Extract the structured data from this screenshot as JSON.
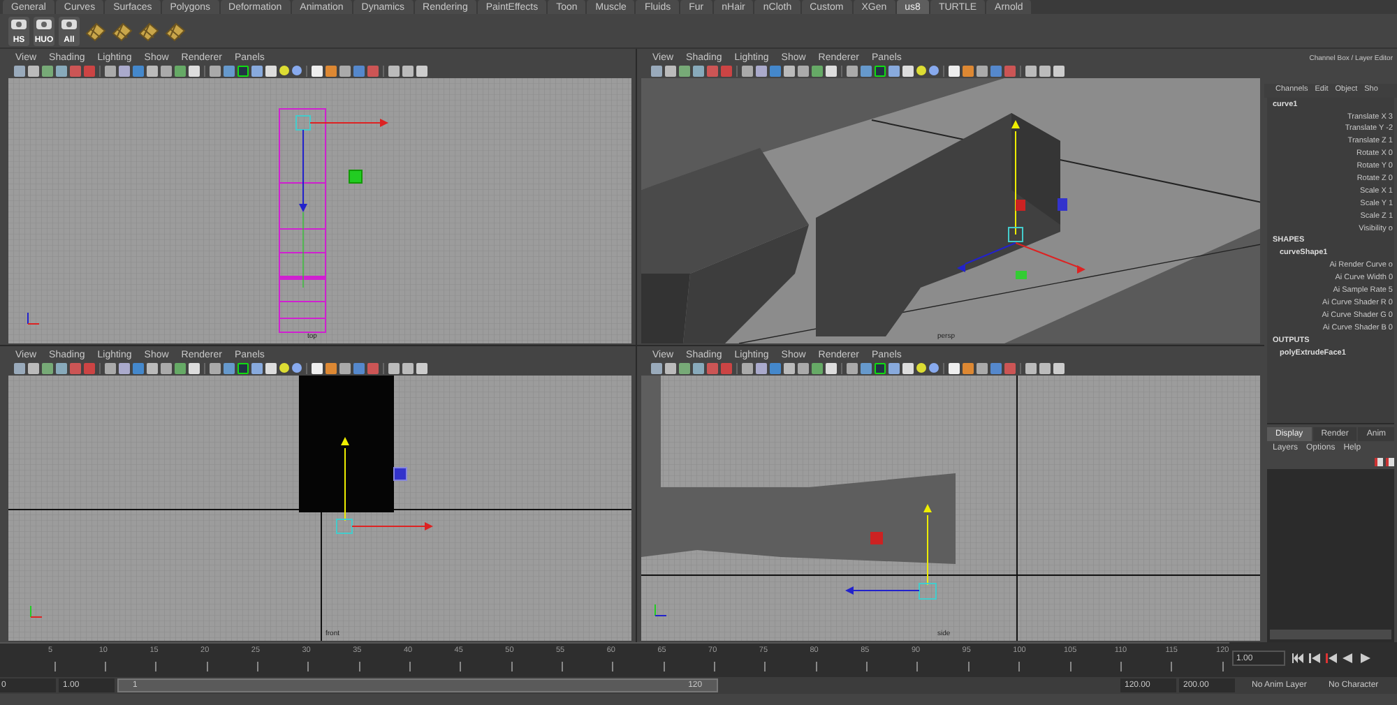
{
  "shelf_tabs": [
    {
      "label": "General",
      "selected": false
    },
    {
      "label": "Curves",
      "selected": false
    },
    {
      "label": "Surfaces",
      "selected": false
    },
    {
      "label": "Polygons",
      "selected": false
    },
    {
      "label": "Deformation",
      "selected": false
    },
    {
      "label": "Animation",
      "selected": false
    },
    {
      "label": "Dynamics",
      "selected": false
    },
    {
      "label": "Rendering",
      "selected": false
    },
    {
      "label": "PaintEffects",
      "selected": false
    },
    {
      "label": "Toon",
      "selected": false
    },
    {
      "label": "Muscle",
      "selected": false
    },
    {
      "label": "Fluids",
      "selected": false
    },
    {
      "label": "Fur",
      "selected": false
    },
    {
      "label": "nHair",
      "selected": false
    },
    {
      "label": "nCloth",
      "selected": false
    },
    {
      "label": "Custom",
      "selected": false
    },
    {
      "label": "XGen",
      "selected": false
    },
    {
      "label": "us8",
      "selected": true
    },
    {
      "label": "TURTLE",
      "selected": false
    },
    {
      "label": "Arnold",
      "selected": false
    }
  ],
  "shelf_buttons": [
    {
      "kind": "camera",
      "label": "HS"
    },
    {
      "kind": "camera",
      "label": "HUO"
    },
    {
      "kind": "camera",
      "label": "All"
    },
    {
      "kind": "tile"
    },
    {
      "kind": "tile"
    },
    {
      "kind": "tile"
    },
    {
      "kind": "tile"
    }
  ],
  "viewports": [
    {
      "kind": "top",
      "menus": [
        "View",
        "Shading",
        "Lighting",
        "Show",
        "Renderer",
        "Panels"
      ],
      "camera": "top"
    },
    {
      "kind": "persp",
      "menus": [
        "View",
        "Shading",
        "Lighting",
        "Show",
        "Renderer",
        "Panels"
      ],
      "camera": "persp"
    },
    {
      "kind": "front",
      "menus": [
        "View",
        "Shading",
        "Lighting",
        "Show",
        "Renderer",
        "Panels"
      ],
      "camera": "front"
    },
    {
      "kind": "side",
      "menus": [
        "View",
        "Shading",
        "Lighting",
        "Show",
        "Renderer",
        "Panels"
      ],
      "camera": "side"
    }
  ],
  "channel_box": {
    "title": "Channel Box / Layer Editor",
    "menus": [
      "Channels",
      "Edit",
      "Object",
      "Sho"
    ],
    "node": "curve1",
    "attributes": [
      "Translate X 3",
      "Translate Y -2",
      "Translate Z 1",
      "Rotate X 0",
      "Rotate Y 0",
      "Rotate Z 0",
      "Scale X 1",
      "Scale Y 1",
      "Scale Z 1",
      "Visibility o"
    ],
    "shapes_header": "SHAPES",
    "shape_node": "curveShape1",
    "shape_attributes": [
      "Ai Render Curve o",
      "Ai Curve Width 0",
      "Ai Sample Rate 5",
      "Ai Curve Shader R 0",
      "Ai Curve Shader G 0",
      "Ai Curve Shader B 0"
    ],
    "outputs_header": "OUTPUTS",
    "output_node": "polyExtrudeFace1"
  },
  "layer_editor": {
    "tabs": [
      {
        "label": "Display",
        "selected": true
      },
      {
        "label": "Render",
        "selected": false
      },
      {
        "label": "Anim",
        "selected": false
      }
    ],
    "menus": [
      "Layers",
      "Options",
      "Help"
    ]
  },
  "timeline": {
    "ticks": [
      "5",
      "10",
      "15",
      "20",
      "25",
      "30",
      "35",
      "40",
      "45",
      "50",
      "55",
      "60",
      "65",
      "70",
      "75",
      "80",
      "85",
      "90",
      "95",
      "100",
      "105",
      "110",
      "115",
      "120"
    ],
    "current_frame": "1.00"
  },
  "range_bar": {
    "start_time": "0",
    "range_start": "1.00",
    "slider_start": "1",
    "slider_end": "120",
    "level": 0.6,
    "range_end": "120.00",
    "end_time": "200.00",
    "anim_layer": "No Anim Layer",
    "character": "No Character"
  }
}
